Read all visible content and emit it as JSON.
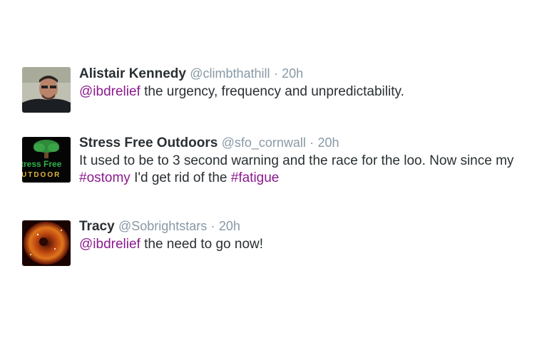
{
  "tweets": [
    {
      "name": "Alistair Kennedy",
      "handle": "@climbthathill",
      "separator": "·",
      "time": "20h",
      "mention": "@ibdrelief",
      "text": " the urgency, frequency and unpredictability."
    },
    {
      "name": "Stress Free Outdoors",
      "handle": "@sfo_cornwall",
      "separator": "·",
      "time": "20h",
      "text_line1": "It used to be to 3 second warning and the race for the loo. Now since my",
      "hashtag1": "#ostomy",
      "text_mid": " I'd get rid of the ",
      "hashtag2": "#fatigue",
      "avatar_text_top": "tress Free",
      "avatar_text_bottom": "UTDOOR"
    },
    {
      "name": "Tracy",
      "handle": "@Sobrightstars",
      "separator": "·",
      "time": "20h",
      "mention": "@ibdrelief",
      "text": " the need to go now!"
    }
  ],
  "colors": {
    "link": "#8b1a8e",
    "meta": "#8899a6",
    "name": "#292f33"
  }
}
